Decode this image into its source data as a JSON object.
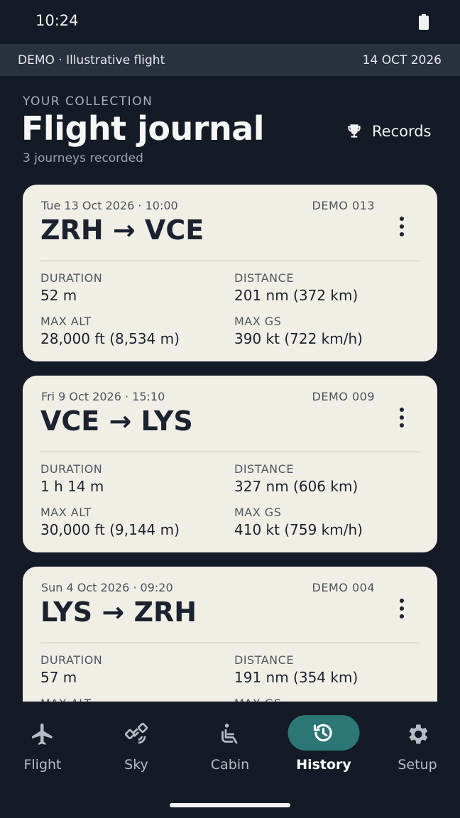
{
  "status_bar": {
    "time": "10:24"
  },
  "demo_banner": {
    "label": "DEMO · Illustrative flight",
    "date": "14 OCT 2026"
  },
  "header": {
    "eyebrow": "YOUR COLLECTION",
    "title": "Flight journal",
    "subtitle": "3 journeys recorded",
    "records_label": "Records"
  },
  "stat_labels": {
    "duration": "DURATION",
    "distance": "DISTANCE",
    "max_alt": "MAX ALT",
    "max_gs": "MAX GS"
  },
  "flights": [
    {
      "date": "Tue 13 Oct 2026 · 10:00",
      "code": "DEMO 013",
      "route": "ZRH → VCE",
      "duration": "52 m",
      "distance": "201 nm (372 km)",
      "max_alt": "28,000 ft (8,534 m)",
      "max_gs": "390 kt (722 km/h)"
    },
    {
      "date": "Fri 9 Oct 2026 · 15:10",
      "code": "DEMO 009",
      "route": "VCE → LYS",
      "duration": "1 h 14 m",
      "distance": "327 nm (606 km)",
      "max_alt": "30,000 ft (9,144 m)",
      "max_gs": "410 kt (759 km/h)"
    },
    {
      "date": "Sun 4 Oct 2026 · 09:20",
      "code": "DEMO 004",
      "route": "LYS → ZRH",
      "duration": "57 m",
      "distance": "191 nm (354 km)",
      "max_alt": "",
      "max_gs": ""
    }
  ],
  "nav": {
    "items": [
      {
        "label": "Flight",
        "icon": "airplane-icon"
      },
      {
        "label": "Sky",
        "icon": "satellite-icon"
      },
      {
        "label": "Cabin",
        "icon": "seat-icon"
      },
      {
        "label": "History",
        "icon": "history-icon",
        "active": true
      },
      {
        "label": "Setup",
        "icon": "gear-icon"
      }
    ]
  },
  "colors": {
    "background": "#141b26",
    "banner": "#28323f",
    "card": "#f1eee6",
    "accent": "#2c7675"
  }
}
